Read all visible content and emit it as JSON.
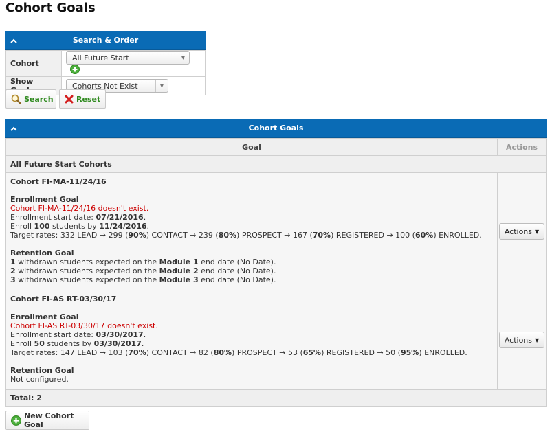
{
  "page": {
    "title": "Cohort Goals"
  },
  "search_panel": {
    "title": "Search & Order",
    "fields": {
      "cohort_label": "Cohort",
      "cohort_value": "All Future Start",
      "show_goals_label": "Show Goals",
      "show_goals_value": "Cohorts Not Exist"
    },
    "search_label": "Search",
    "reset_label": "Reset"
  },
  "goals_panel": {
    "title": "Cohort Goals",
    "col_goal": "Goal",
    "col_actions": "Actions",
    "group_label": "All Future Start Cohorts",
    "actions_label": "Actions",
    "enrollment_heading": "Enrollment Goal",
    "retention_heading": "Retention Goal",
    "cohorts": [
      {
        "name": "Cohort FI-MA-11/24/16",
        "error": "Cohort FI-MA-11/24/16 doesn't exist.",
        "start_date": "07/21/2016",
        "enroll_count": "100",
        "enroll_by": "11/24/2016",
        "rates": {
          "lead": "332",
          "contact": "299",
          "contact_pct": "90%",
          "prospect": "239",
          "prospect_pct": "80%",
          "registered": "167",
          "registered_pct": "70%",
          "enrolled": "100",
          "enrolled_pct": "60%"
        },
        "retention": [
          {
            "count": "1",
            "module": "Module 1"
          },
          {
            "count": "2",
            "module": "Module 2"
          },
          {
            "count": "3",
            "module": "Module 3"
          }
        ]
      },
      {
        "name": "Cohort FI-AS RT-03/30/17",
        "error": "Cohort FI-AS RT-03/30/17 doesn't exist.",
        "start_date": "03/30/2017",
        "enroll_count": "50",
        "enroll_by": "03/30/2017",
        "rates": {
          "lead": "147",
          "contact": "103",
          "contact_pct": "70%",
          "prospect": "82",
          "prospect_pct": "80%",
          "registered": "53",
          "registered_pct": "65%",
          "enrolled": "50",
          "enrolled_pct": "95%"
        },
        "retention_text": "Not configured."
      }
    ],
    "total_label": "Total: 2"
  },
  "new_goal_label": "New Cohort Goal",
  "colors": {
    "header_blue": "#0a6bb5",
    "error_red": "#cc0000",
    "green": "#2f8a1f"
  }
}
